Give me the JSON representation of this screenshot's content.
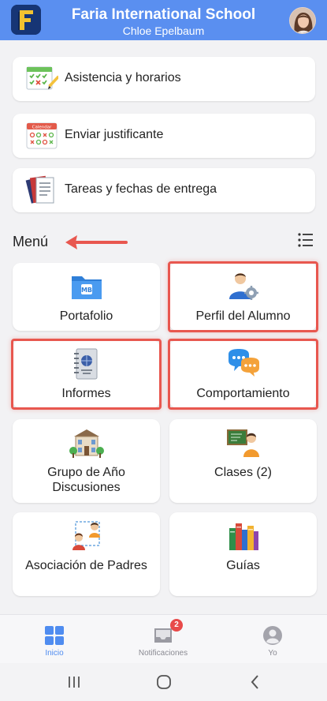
{
  "header": {
    "school_name": "Faria International School",
    "student_name": "Chloe Epelbaum",
    "brand_color": "#5a8ff0",
    "logo_icon": "faria-logo-icon",
    "avatar_icon": "student-avatar"
  },
  "quick_links": [
    {
      "label": "Asistencia y horarios",
      "icon": "attendance-checklist-icon"
    },
    {
      "label": "Enviar justificante",
      "icon": "calendar-icon",
      "icon_text": "Calendar"
    },
    {
      "label": "Tareas y fechas de entrega",
      "icon": "tasks-documents-icon"
    }
  ],
  "menu": {
    "title": "Menú",
    "view_toggle_icon": "list-view-icon",
    "annotation": {
      "arrow_color": "#e8574f"
    },
    "tiles": [
      {
        "label": "Portafolio",
        "icon": "portfolio-folder-icon",
        "icon_text": "MB",
        "highlighted": false
      },
      {
        "label": "Perfil del Alumno",
        "icon": "student-profile-icon",
        "highlighted": true
      },
      {
        "label": "Informes",
        "icon": "reports-notebook-icon",
        "highlighted": true
      },
      {
        "label": "Comportamiento",
        "icon": "behaviour-chat-icon",
        "highlighted": true
      },
      {
        "label": "Grupo de Año Discusiones",
        "icon": "school-building-icon",
        "highlighted": false
      },
      {
        "label": "Clases (2)",
        "icon": "classes-teacher-icon",
        "highlighted": false
      },
      {
        "label": "Asociación de Padres",
        "icon": "parents-association-icon",
        "highlighted": false
      },
      {
        "label": "Guías",
        "icon": "guides-books-icon",
        "highlighted": false
      }
    ]
  },
  "bottom_nav": [
    {
      "label": "Inicio",
      "icon": "home-grid-icon",
      "active": true
    },
    {
      "label": "Notificaciones",
      "icon": "inbox-icon",
      "badge": "2"
    },
    {
      "label": "Yo",
      "icon": "profile-icon"
    }
  ],
  "system_nav": [
    "recent-apps-icon",
    "home-circle-icon",
    "back-chevron-icon"
  ]
}
